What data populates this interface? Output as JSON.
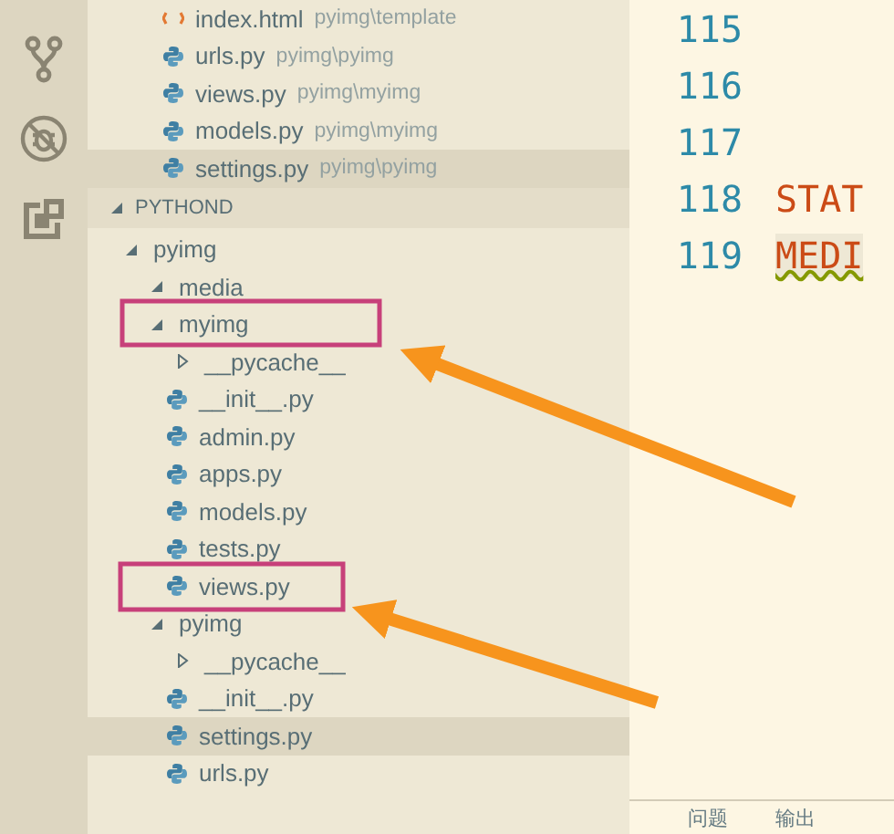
{
  "activity_bar": [
    {
      "kind": "source-control",
      "selected": false
    },
    {
      "kind": "debug",
      "selected": false
    },
    {
      "kind": "extensions",
      "selected": false
    }
  ],
  "open_editors": [
    {
      "kind": "html",
      "name": "index.html",
      "path": "pyimg\\template",
      "selected": false
    },
    {
      "kind": "python",
      "name": "urls.py",
      "path": "pyimg\\pyimg",
      "selected": false
    },
    {
      "kind": "python",
      "name": "views.py",
      "path": "pyimg\\myimg",
      "selected": false
    },
    {
      "kind": "python",
      "name": "models.py",
      "path": "pyimg\\myimg",
      "selected": false
    },
    {
      "kind": "python",
      "name": "settings.py",
      "path": "pyimg\\pyimg",
      "selected": true
    }
  ],
  "section": {
    "title": "PYTHOND",
    "expanded": true
  },
  "tree": [
    {
      "kind": "folder",
      "name": "pyimg",
      "expanded": true,
      "selected": false,
      "children": [
        {
          "kind": "folder",
          "name": "media",
          "expanded": true,
          "selected": false
        },
        {
          "kind": "folder",
          "name": "myimg",
          "expanded": true,
          "selected": false,
          "children": [
            {
              "kind": "folder",
              "name": "__pycache__",
              "expanded": false,
              "selected": false
            },
            {
              "kind": "python",
              "name": "__init__.py",
              "selected": false
            },
            {
              "kind": "python",
              "name": "admin.py",
              "selected": false
            },
            {
              "kind": "python",
              "name": "apps.py",
              "selected": false
            },
            {
              "kind": "python",
              "name": "models.py",
              "selected": false
            },
            {
              "kind": "python",
              "name": "tests.py",
              "selected": false
            },
            {
              "kind": "python",
              "name": "views.py",
              "selected": false
            }
          ]
        },
        {
          "kind": "folder",
          "name": "pyimg",
          "expanded": true,
          "selected": false,
          "children": [
            {
              "kind": "folder",
              "name": "__pycache__",
              "expanded": false,
              "selected": false
            },
            {
              "kind": "python",
              "name": "__init__.py",
              "selected": false
            },
            {
              "kind": "python",
              "name": "settings.py",
              "selected": true
            },
            {
              "kind": "python",
              "name": "urls.py",
              "selected": false
            }
          ]
        }
      ]
    }
  ],
  "editor": {
    "lines": [
      {
        "number": "115"
      },
      {
        "number": "116"
      },
      {
        "number": "117"
      },
      {
        "number": "118",
        "code": "STAT",
        "squiggle": false,
        "current": false
      },
      {
        "number": "119",
        "code": "MEDI",
        "squiggle": true,
        "current": true
      }
    ]
  },
  "panel_tabs": [
    {
      "label": "问题",
      "selected": false
    },
    {
      "label": "输出",
      "selected": false
    }
  ]
}
